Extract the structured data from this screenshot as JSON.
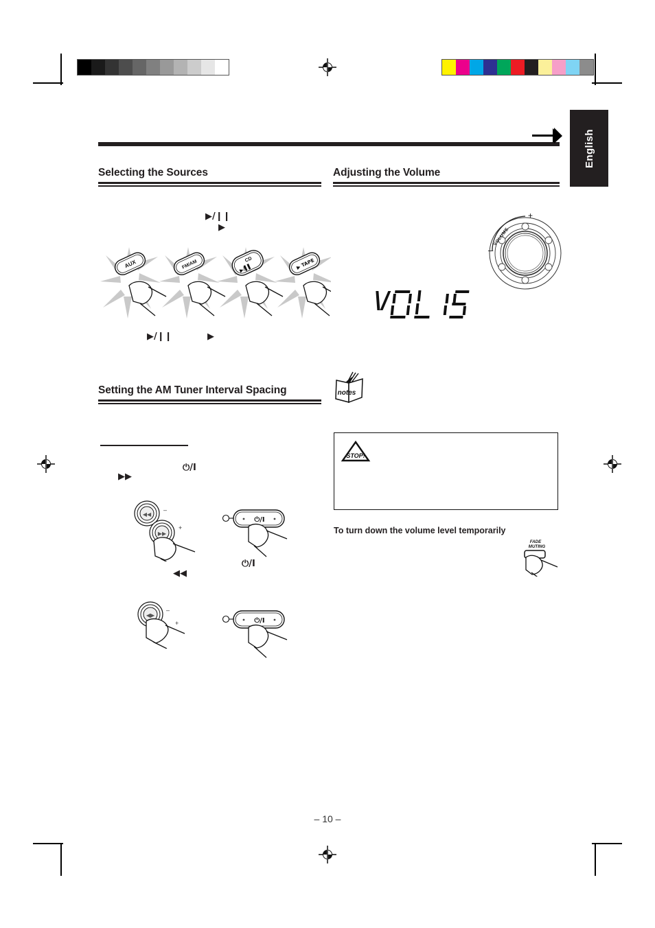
{
  "document": {
    "page_number": "– 10 –",
    "language_tab": "English"
  },
  "prepress": {
    "grayscale_bar": [
      "#000000",
      "#1a1a1a",
      "#333333",
      "#4d4d4d",
      "#666666",
      "#808080",
      "#999999",
      "#b3b3b3",
      "#cccccc",
      "#e6e6e6",
      "#ffffff"
    ],
    "color_bar": [
      "#fff200",
      "#ec008c",
      "#00a7e7",
      "#2e3192",
      "#00a65a",
      "#ed1c24",
      "#231f20",
      "#fbf09a",
      "#f69fc8",
      "#7fd4f4",
      "#8c8c8c"
    ],
    "registration_icon": "registration-target-icon"
  },
  "sections": {
    "selecting_sources": {
      "heading": "Selecting the Sources",
      "symbol_top_1": "▶/❙❙",
      "symbol_top_2": "▶",
      "symbol_bottom_1": "▶/❙❙",
      "symbol_bottom_2": "▶",
      "buttons": [
        {
          "label": "AUX",
          "sub": ""
        },
        {
          "label": "FM/AM",
          "sub": ""
        },
        {
          "label": "CD",
          "sub": "▶/❙❙"
        },
        {
          "label": "TAPE",
          "sub": "▶"
        }
      ]
    },
    "am_tuner": {
      "heading": "Setting the AM Tuner Interval Spacing",
      "symbol_ff": "▶▶",
      "symbol_rew": "◀◀",
      "symbol_power_1": "⏻/I",
      "symbol_power_2": "⏻/I",
      "remote_label_1": "⏻/I",
      "remote_label_2": "⏻/I",
      "knob_minus": "–",
      "knob_plus": "+",
      "unit_button_ff": "▶▶",
      "unit_button_rew": "◀◀"
    },
    "adjusting_volume": {
      "heading": "Adjusting the Volume",
      "knob_label": "VOLUME",
      "knob_minus": "–",
      "knob_plus": "+",
      "display_text": "VOL 15",
      "display_word": "VOL",
      "display_value": "15",
      "notes_icon_label": "notes",
      "caution_icon_label": "STOP!",
      "subheading": "To turn down the volume level temporarily",
      "fade_muting_button": {
        "line1": "FADE",
        "line2": "MUTING"
      }
    }
  }
}
